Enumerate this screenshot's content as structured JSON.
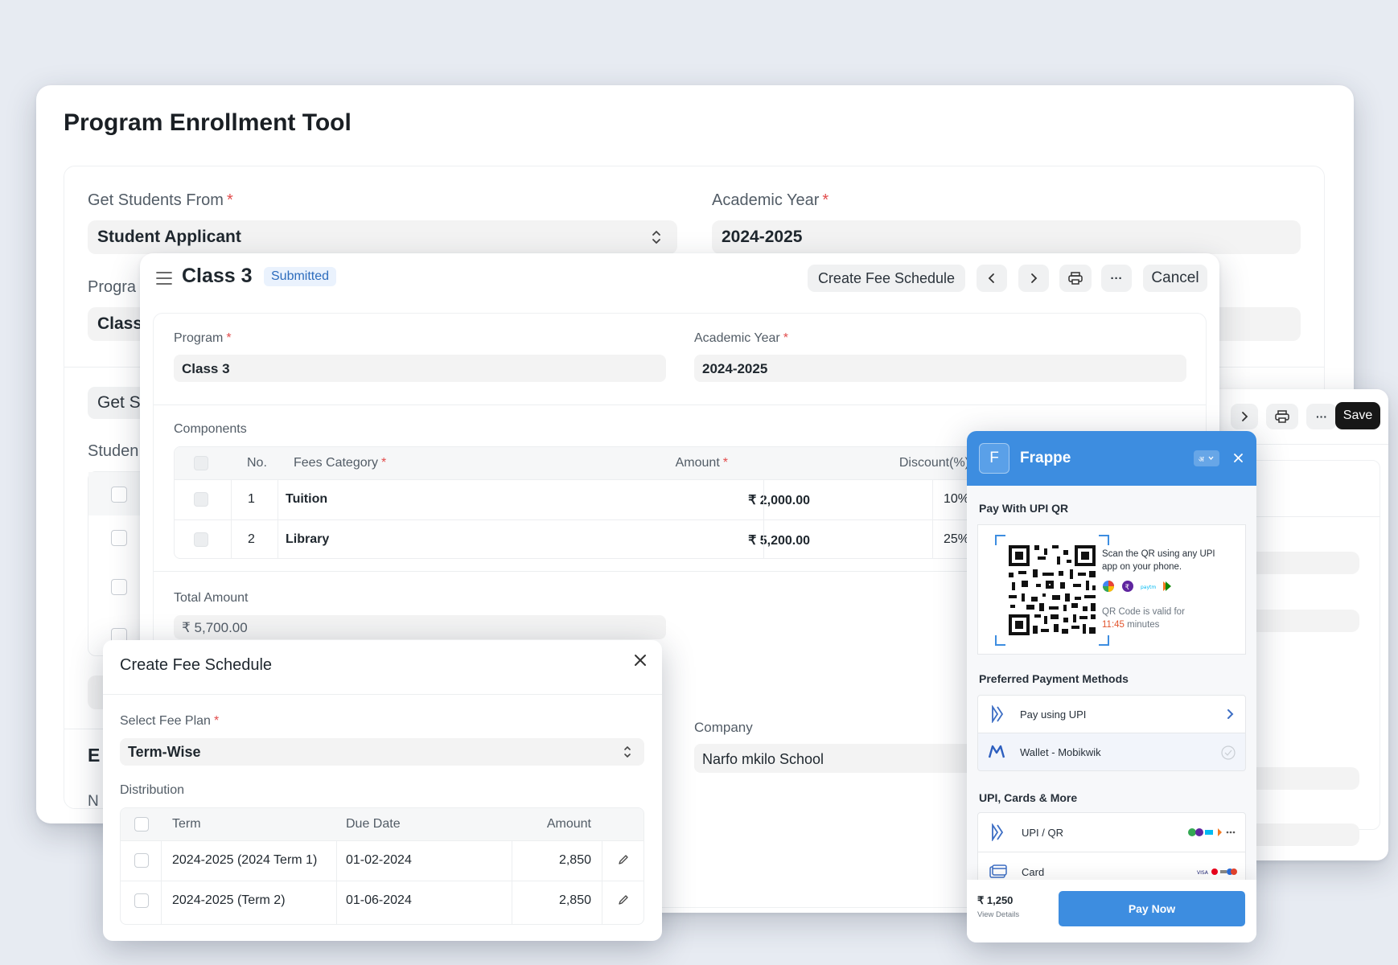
{
  "enroll": {
    "title": "Program Enrollment Tool",
    "get_students_from_label": "Get Students From",
    "get_students_from_value": "Student Applicant",
    "academic_year_label": "Academic Year",
    "academic_year_value": "2024-2025",
    "program_label_partial": "Progra",
    "program_value_partial": "Class",
    "get_button_partial": "Get S",
    "students_label_partial": "Studen",
    "section_partial": "E",
    "section2_partial": "N"
  },
  "right_panel": {
    "save_label": "Save"
  },
  "doc": {
    "title": "Class 3",
    "status": "Submitted",
    "create_fee_schedule": "Create Fee Schedule",
    "cancel": "Cancel",
    "program_label": "Program",
    "program_value": "Class 3",
    "academic_year_label": "Academic Year",
    "academic_year_value": "2024-2025",
    "components_label": "Components",
    "columns": {
      "no": "No.",
      "fees_category": "Fees Category",
      "amount": "Amount",
      "discount": "Discount(%)"
    },
    "rows": [
      {
        "no": "1",
        "category": "Tuition",
        "amount": "₹ 2,000.00",
        "discount": "10%"
      },
      {
        "no": "2",
        "category": "Library",
        "amount": "₹ 5,200.00",
        "discount": "25%"
      }
    ],
    "total_amount_label": "Total Amount",
    "total_amount_value": "₹ 5,700.00",
    "company_label": "Company",
    "company_value": "Narfo mkilo School"
  },
  "fee_modal": {
    "title": "Create Fee Schedule",
    "select_fee_plan_label": "Select Fee Plan",
    "select_fee_plan_value": "Term-Wise",
    "distribution_label": "Distribution",
    "columns": {
      "term": "Term",
      "due_date": "Due Date",
      "amount": "Amount"
    },
    "rows": [
      {
        "term": "2024-2025 (2024 Term 1)",
        "due_date": "01-02-2024",
        "amount": "2,850"
      },
      {
        "term": "2024-2025 (Term 2)",
        "due_date": "01-06-2024",
        "amount": "2,850"
      }
    ]
  },
  "payment": {
    "avatar_letter": "F",
    "merchant": "Frappe",
    "pay_with_upi_qr": "Pay With UPI QR",
    "scan_text": "Scan the QR using any UPI app on your phone.",
    "valid_text": "QR Code is valid for",
    "valid_time": "11:45",
    "valid_unit": "minutes",
    "preferred_label": "Preferred Payment Methods",
    "pay_using_upi": "Pay using UPI",
    "wallet": "Wallet - Mobikwik",
    "more_label": "UPI, Cards & More",
    "upi_qr": "UPI / QR",
    "card": "Card",
    "amount": "₹ 1,250",
    "view_details": "View Details",
    "pay_now": "Pay Now",
    "accent": "#3d8de0"
  }
}
